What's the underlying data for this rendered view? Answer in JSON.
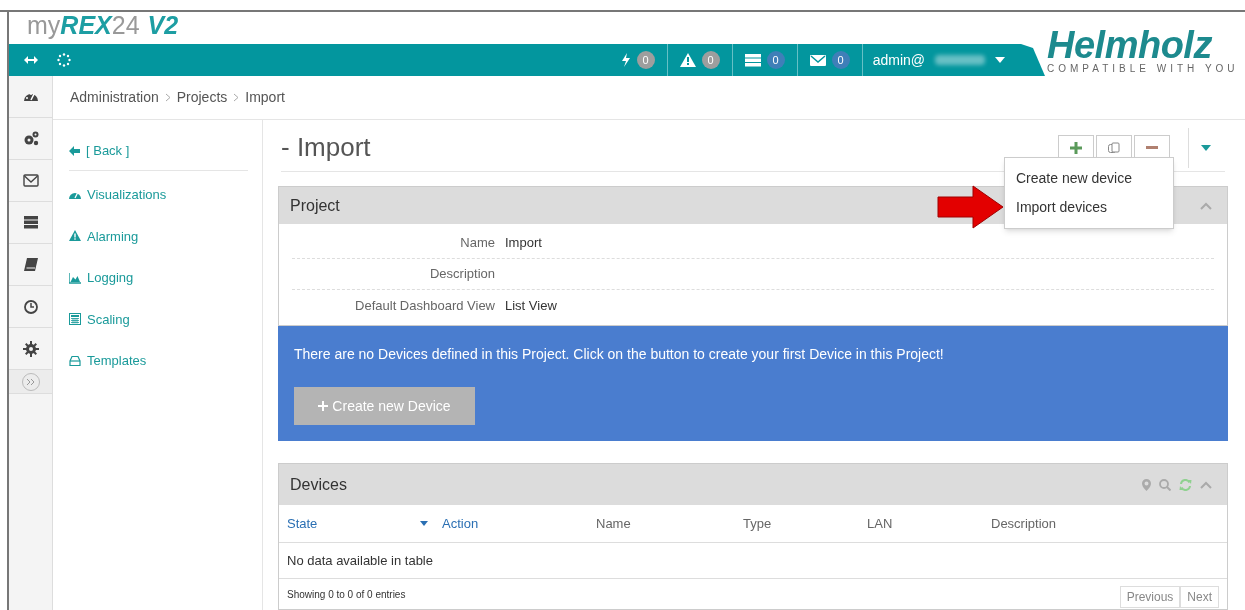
{
  "logo": {
    "brand_prefix": "my",
    "brand_name": "REX",
    "brand_number": "24",
    "brand_version": "V2"
  },
  "top_bar": {
    "counters": [
      {
        "kind": "power",
        "count": "0",
        "color": "#9e9e9e"
      },
      {
        "kind": "alarm",
        "count": "0",
        "color": "#9e9e9e"
      },
      {
        "kind": "server",
        "count": "0",
        "color": "#3f7fb8"
      },
      {
        "kind": "mail",
        "count": "0",
        "color": "#3f7fb8"
      }
    ],
    "user": "admin@"
  },
  "company_logo": {
    "name": "Helmholz",
    "tagline": "COMPATIBLE WITH YOU"
  },
  "icon_sidebar": {
    "items": [
      {
        "kind": "dashboard"
      },
      {
        "kind": "gears"
      },
      {
        "kind": "mail"
      },
      {
        "kind": "server"
      },
      {
        "kind": "book"
      },
      {
        "kind": "clock"
      },
      {
        "kind": "gear"
      },
      {
        "kind": "expand"
      }
    ]
  },
  "breadcrumb": [
    "Administration",
    "Projects",
    "Import"
  ],
  "nav_sidebar": {
    "back": "[ Back ]",
    "items": [
      {
        "kind": "dashboard",
        "label": "Visualizations"
      },
      {
        "kind": "alarm",
        "label": "Alarming"
      },
      {
        "kind": "chart",
        "label": "Logging"
      },
      {
        "kind": "calculator",
        "label": "Scaling"
      },
      {
        "kind": "templates",
        "label": "Templates"
      }
    ]
  },
  "page_title": "- Import",
  "toolbar": {
    "buttons": [
      {
        "kind": "add"
      },
      {
        "kind": "copy"
      },
      {
        "kind": "remove"
      }
    ]
  },
  "dropdown_menu": {
    "items": [
      {
        "label": "Create new device"
      },
      {
        "label": "Import devices"
      }
    ]
  },
  "project_panel": {
    "title": "Project",
    "fields": [
      {
        "label": "Name",
        "value": "Import"
      },
      {
        "label": "Description"
      },
      {
        "label": "Default Dashboard View",
        "value": "List View"
      }
    ]
  },
  "notice": {
    "text": "There are no Devices defined in this Project. Click on the button to create your first Device in this Project!",
    "button": "Create new Device"
  },
  "devices_panel": {
    "title": "Devices",
    "columns": [
      {
        "label": "State",
        "sortable": true
      },
      {
        "label": "Action",
        "sortable": true
      },
      {
        "label": "Name",
        "sortable": false
      },
      {
        "label": "Type",
        "sortable": false
      },
      {
        "label": "LAN",
        "sortable": false
      },
      {
        "label": "Description",
        "sortable": false
      }
    ],
    "empty_text": "No data available in table",
    "info": "Showing 0 to 0 of 0 entries",
    "pagination": [
      "Previous",
      "Next"
    ]
  }
}
